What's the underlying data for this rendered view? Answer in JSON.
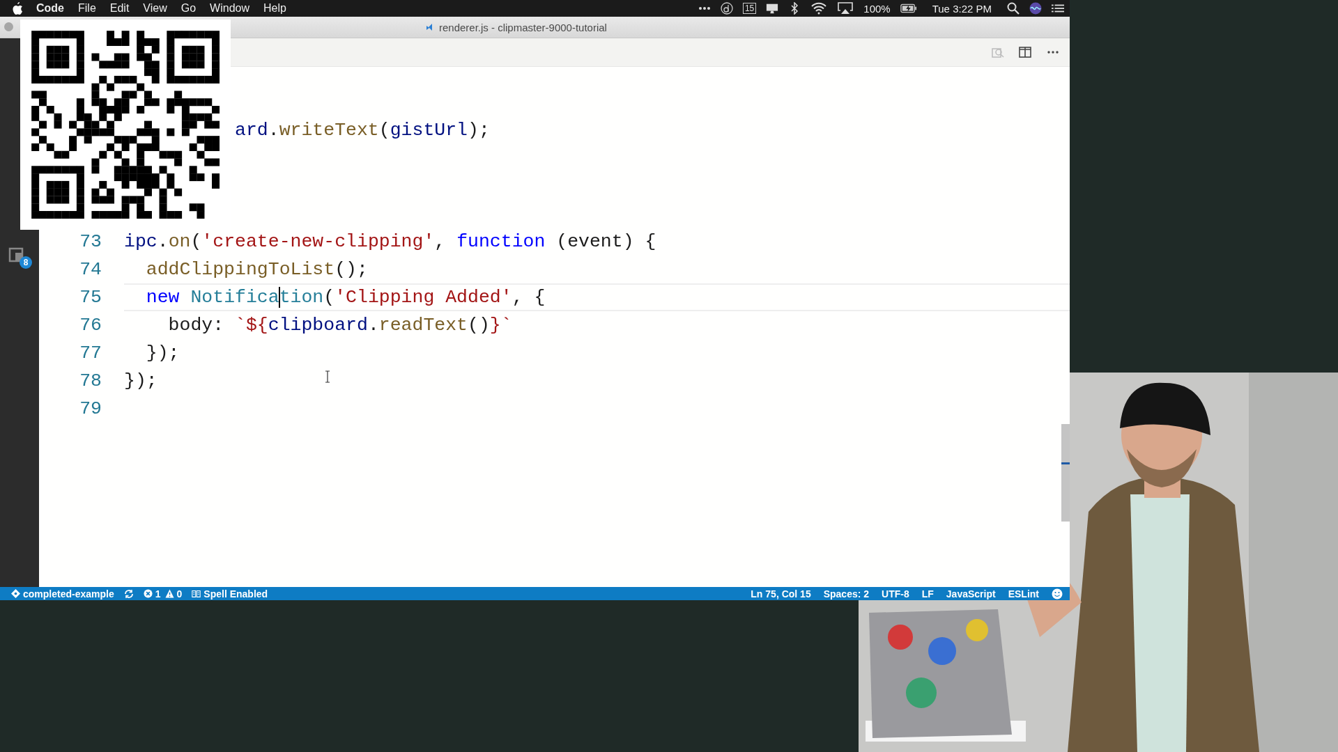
{
  "menu_bar": {
    "app": "Code",
    "items": [
      "File",
      "Edit",
      "View",
      "Go",
      "Window",
      "Help"
    ],
    "calendar": "15",
    "battery": "100%",
    "clock": "Tue 3:22 PM"
  },
  "window": {
    "title": "renderer.js - clipmaster-9000-tutorial"
  },
  "activity_bar": {
    "badge": "8"
  },
  "editor": {
    "lines": [
      {
        "kind": "partial",
        "tokens": [
          {
            "kind": "var",
            "text": "ard"
          },
          {
            "kind": "plain",
            "text": "."
          },
          {
            "kind": "method",
            "text": "writeText"
          },
          {
            "kind": "plain",
            "text": "("
          },
          {
            "kind": "var",
            "text": "gistUrl"
          },
          {
            "kind": "plain",
            "text": ");"
          }
        ]
      },
      {
        "kind": "hidden"
      },
      {
        "kind": "hidden"
      },
      {
        "kind": "hidden"
      },
      {
        "kind": "line",
        "number": "73",
        "current": false,
        "tokens": [
          {
            "kind": "var",
            "text": "ipc"
          },
          {
            "kind": "plain",
            "text": "."
          },
          {
            "kind": "method",
            "text": "on"
          },
          {
            "kind": "plain",
            "text": "("
          },
          {
            "kind": "string",
            "text": "'create-new-clipping'"
          },
          {
            "kind": "plain",
            "text": ", "
          },
          {
            "kind": "keyword",
            "text": "function"
          },
          {
            "kind": "plain",
            "text": " (event) {"
          }
        ]
      },
      {
        "kind": "line",
        "number": "74",
        "current": false,
        "tokens": [
          {
            "kind": "method",
            "text": "  addClippingToList"
          },
          {
            "kind": "plain",
            "text": "();"
          }
        ]
      },
      {
        "kind": "line",
        "number": "75",
        "current": true,
        "tokens": [
          {
            "kind": "keyword",
            "text": "  new"
          },
          {
            "kind": "type",
            "text": " Notifica"
          },
          {
            "kind": "caret"
          },
          {
            "kind": "type",
            "text": "tion"
          },
          {
            "kind": "plain",
            "text": "("
          },
          {
            "kind": "string",
            "text": "'Clipping Added'"
          },
          {
            "kind": "plain",
            "text": ", {"
          }
        ]
      },
      {
        "kind": "line",
        "number": "76",
        "current": false,
        "tokens": [
          {
            "kind": "plain",
            "text": "    body: "
          },
          {
            "kind": "string",
            "text": "`${"
          },
          {
            "kind": "var",
            "text": "clipboard"
          },
          {
            "kind": "plain",
            "text": "."
          },
          {
            "kind": "method",
            "text": "readText"
          },
          {
            "kind": "plain",
            "text": "()"
          },
          {
            "kind": "string",
            "text": "}`"
          }
        ]
      },
      {
        "kind": "line",
        "number": "77",
        "current": false,
        "tokens": [
          {
            "kind": "plain",
            "text": "  });"
          }
        ]
      },
      {
        "kind": "line",
        "number": "78",
        "current": false,
        "tokens": [
          {
            "kind": "plain",
            "text": "});"
          }
        ]
      },
      {
        "kind": "line",
        "number": "79",
        "current": false
      }
    ]
  },
  "status_bar": {
    "left": [
      {
        "kind": "branch",
        "text": "completed-example"
      },
      {
        "kind": "sync"
      },
      {
        "kind": "error",
        "text": "1"
      },
      {
        "kind": "warning",
        "text": "0"
      },
      {
        "kind": "book",
        "text": "Spell Enabled"
      }
    ],
    "right": [
      "Ln 75, Col 15",
      "Spaces: 2",
      "UTF-8",
      "LF",
      "JavaScript",
      "ESLint"
    ]
  }
}
